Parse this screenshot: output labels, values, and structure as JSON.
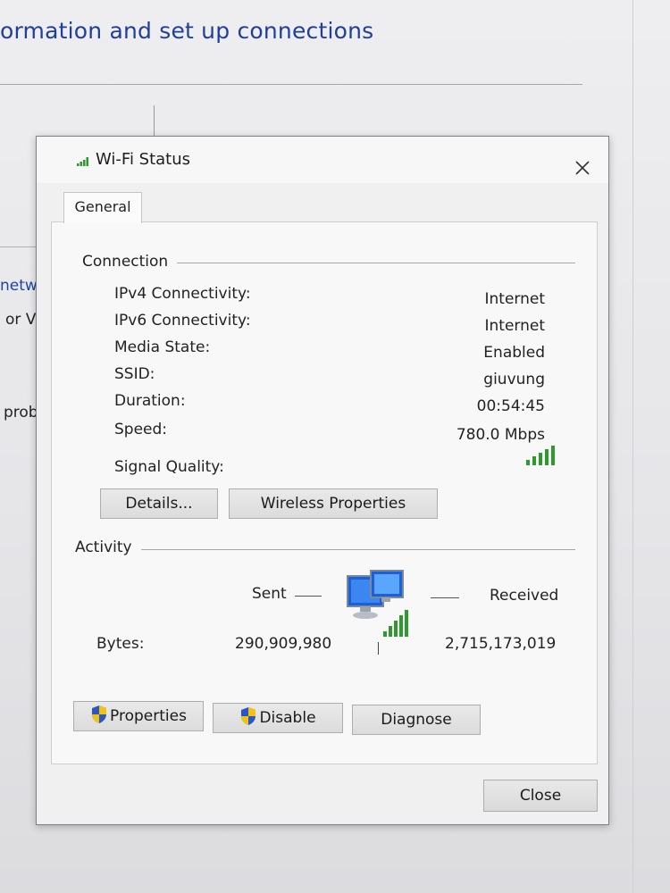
{
  "background": {
    "title_fragment": "ormation and set up connections",
    "side_text_1": "netwo",
    "side_text_2": "or VF",
    "side_text_3": "prob"
  },
  "dialog": {
    "title": "Wi-Fi Status",
    "tab_label": "General",
    "connection": {
      "group_label": "Connection",
      "rows": [
        {
          "label": "IPv4 Connectivity:",
          "value": "Internet"
        },
        {
          "label": "IPv6 Connectivity:",
          "value": "Internet"
        },
        {
          "label": "Media State:",
          "value": "Enabled"
        },
        {
          "label": "SSID:",
          "value": "giuvung"
        },
        {
          "label": "Duration:",
          "value": "00:54:45"
        },
        {
          "label": "Speed:",
          "value": "780.0 Mbps"
        }
      ],
      "signal_label": "Signal Quality:",
      "signal_bars": 5,
      "details_button": "Details...",
      "wireless_button": "Wireless Properties"
    },
    "activity": {
      "group_label": "Activity",
      "sent_label": "Sent",
      "received_label": "Received",
      "bytes_label": "Bytes:",
      "bytes_sent": "290,909,980",
      "bytes_received": "2,715,173,019"
    },
    "buttons": {
      "properties": "Properties",
      "disable": "Disable",
      "diagnose": "Diagnose",
      "close": "Close"
    }
  },
  "colors": {
    "link_blue": "#1d45a8",
    "signal_green": "#2e9a2e",
    "shield_blue": "#2a56c6",
    "shield_yellow": "#f2c40f"
  },
  "icons": {
    "title": "wifi-signal-icon",
    "close": "close-icon",
    "shield": "uac-shield-icon",
    "network": "network-computers-icon"
  }
}
